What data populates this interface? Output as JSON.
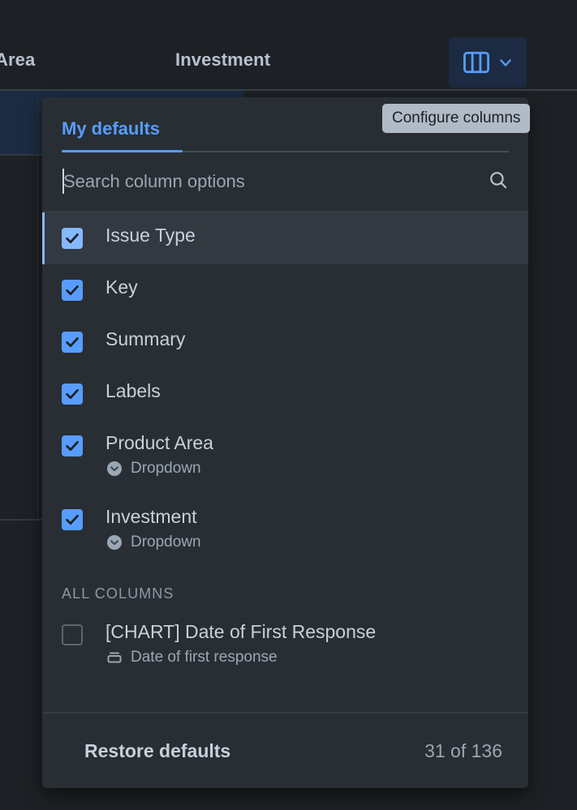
{
  "background": {
    "column_headers": [
      {
        "label": "Area"
      },
      {
        "label": "Investment"
      }
    ]
  },
  "configure_button": {
    "icon": "columns-icon",
    "chevron_icon": "chevron-down-icon",
    "accent_color": "#579dff",
    "background_color": "#1c2b41"
  },
  "tooltip": {
    "text": "Configure columns",
    "background_color": "#b1bbc7",
    "text_color": "#1c2024"
  },
  "panel": {
    "tabs": [
      {
        "label": "My defaults",
        "selected": true
      }
    ],
    "search": {
      "placeholder": "Search column options",
      "value": "",
      "icon": "search-icon"
    },
    "selected_section": {
      "options": [
        {
          "label": "Issue Type",
          "checked": true,
          "hovered": true,
          "sub": null,
          "sub_icon": null
        },
        {
          "label": "Key",
          "checked": true,
          "hovered": false,
          "sub": null,
          "sub_icon": null
        },
        {
          "label": "Summary",
          "checked": true,
          "hovered": false,
          "sub": null,
          "sub_icon": null
        },
        {
          "label": "Labels",
          "checked": true,
          "hovered": false,
          "sub": null,
          "sub_icon": null
        },
        {
          "label": "Product Area",
          "checked": true,
          "hovered": false,
          "sub": "Dropdown",
          "sub_icon": "dropdown-circle-icon"
        },
        {
          "label": "Investment",
          "checked": true,
          "hovered": false,
          "sub": "Dropdown",
          "sub_icon": "dropdown-circle-icon"
        }
      ]
    },
    "all_columns_section": {
      "heading": "All columns",
      "options": [
        {
          "label": "[CHART] Date of First Response",
          "checked": false,
          "hovered": false,
          "sub": "Date of first response",
          "sub_icon": "date-field-icon"
        }
      ]
    },
    "footer": {
      "restore_label": "Restore defaults",
      "count_label": "31 of 136"
    }
  }
}
